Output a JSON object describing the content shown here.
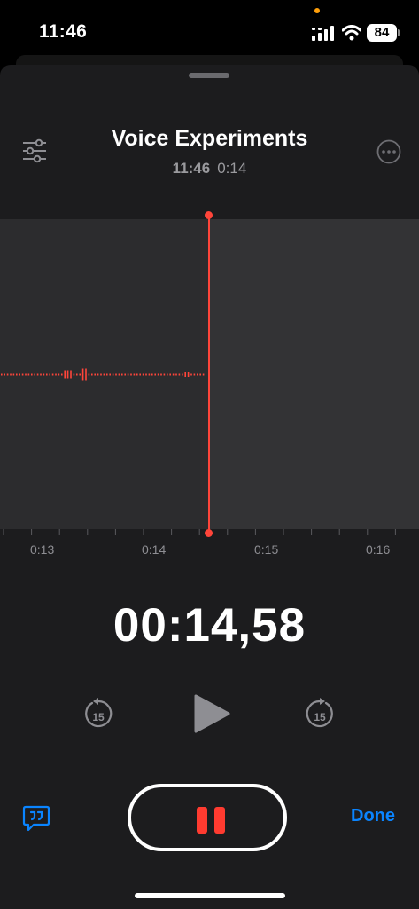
{
  "status_bar": {
    "time": "11:46",
    "battery": "84"
  },
  "header": {
    "title": "Voice Experiments",
    "recorded_time": "11:46",
    "duration": "0:14"
  },
  "timeline": {
    "ticks": [
      "0:13",
      "0:14",
      "0:15",
      "0:16"
    ]
  },
  "playback": {
    "elapsed": "00:14,58",
    "skip_back_seconds": "15",
    "skip_forward_seconds": "15"
  },
  "bottom_bar": {
    "done_label": "Done"
  },
  "colors": {
    "accent_red": "#ff453a",
    "link_blue": "#0a84ff",
    "sheet_bg": "#1c1c1e"
  }
}
